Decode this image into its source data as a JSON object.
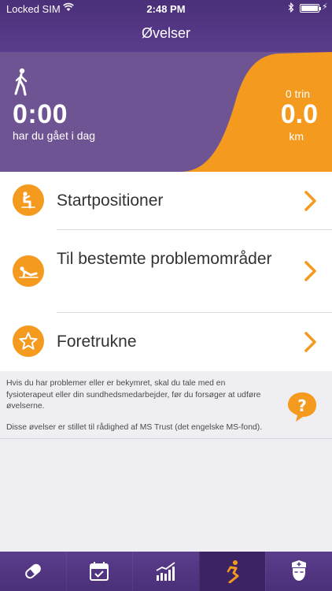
{
  "status_bar": {
    "carrier": "Locked SIM",
    "time": "2:48 PM"
  },
  "nav": {
    "title": "Øvelser"
  },
  "summary": {
    "time_value": "0:00",
    "time_label": "har du gået i dag",
    "steps_label": "0 trin",
    "distance_value": "0.0",
    "distance_unit": "km"
  },
  "menu": {
    "items": [
      {
        "label": "Startpositioner",
        "icon": "exercise-position-icon"
      },
      {
        "label": "Til bestemte problemområder",
        "icon": "stretch-icon"
      },
      {
        "label": "Foretrukne",
        "icon": "star-icon"
      }
    ]
  },
  "info": {
    "paragraph1": "Hvis du har problemer eller er bekymret, skal du tale med en fysioterapeut eller din sundhedsmedarbejder, før du forsøger at udføre øvelserne.",
    "paragraph2": "Disse øvelser er stillet til rådighed af MS Trust (det engelske MS-fond).",
    "help_icon": "help-bubble-icon"
  },
  "tabs": [
    {
      "name": "medication",
      "icon": "pill-icon",
      "active": false
    },
    {
      "name": "calendar",
      "icon": "calendar-check-icon",
      "active": false
    },
    {
      "name": "chart",
      "icon": "bar-chart-icon",
      "active": false
    },
    {
      "name": "exercise",
      "icon": "exercise-icon",
      "active": true
    },
    {
      "name": "nurse",
      "icon": "nurse-icon",
      "active": false
    }
  ],
  "colors": {
    "purple": "#5b3d8c",
    "purple_dark": "#3c2463",
    "hero_purple": "#6f5494",
    "orange": "#f49a1e",
    "info_bg": "#efeef3"
  }
}
